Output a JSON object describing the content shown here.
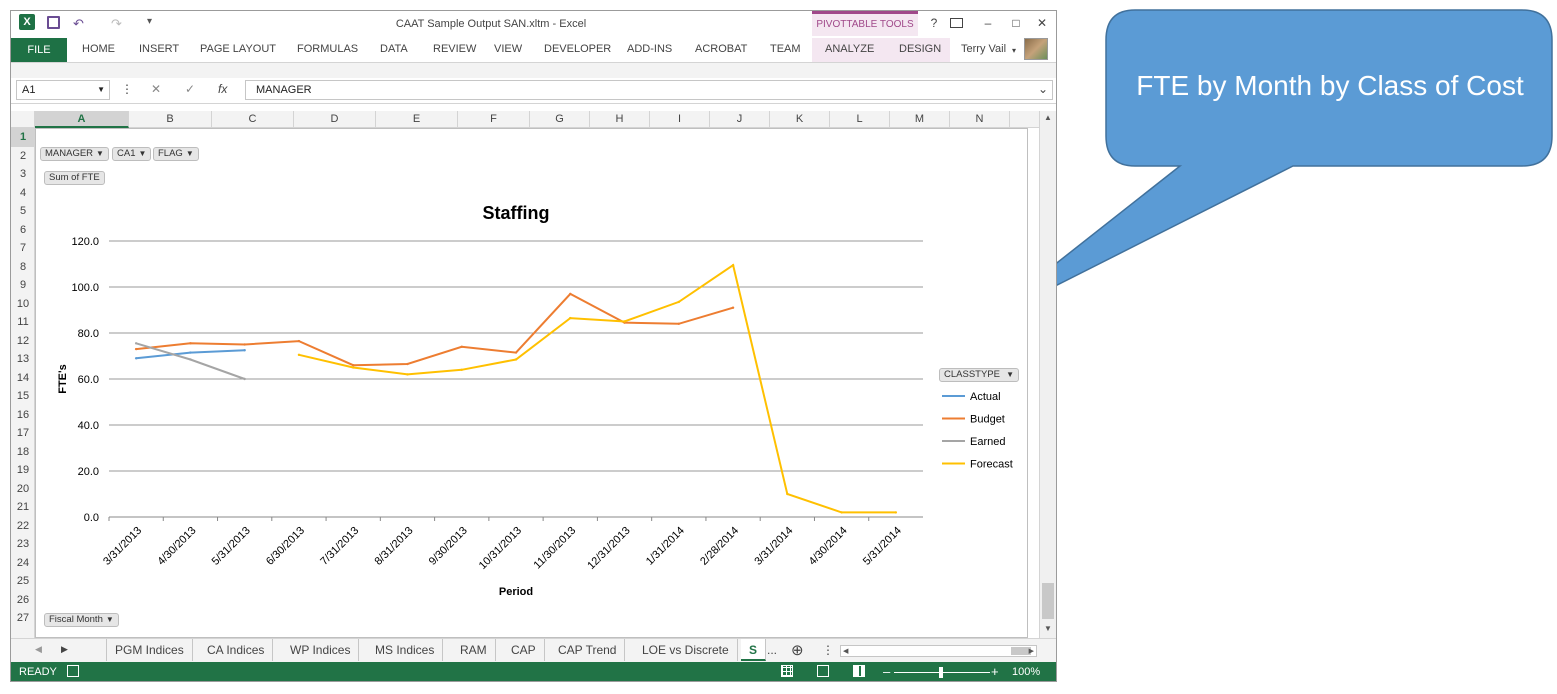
{
  "window": {
    "title": "CAAT Sample Output SAN.xltm - Excel",
    "contextual_tab_group": "PIVOTTABLE TOOLS",
    "help": "?",
    "restore_icon": "ribbon-display-icon",
    "minimize": "–",
    "maximize": "□",
    "close": "✕"
  },
  "quick_access": {
    "excel_icon": "X",
    "save_icon": "save-icon",
    "undo": "↶",
    "redo": "↷",
    "customize": "▾"
  },
  "ribbon": {
    "file": "FILE",
    "tabs": [
      "HOME",
      "INSERT",
      "PAGE LAYOUT",
      "FORMULAS",
      "DATA",
      "REVIEW",
      "VIEW",
      "DEVELOPER",
      "ADD-INS",
      "ACROBAT",
      "TEAM",
      "ANALYZE",
      "DESIGN"
    ],
    "user": "Terry Vail",
    "user_caret": "▾"
  },
  "formula_bar": {
    "name_box": "A1",
    "cancel": "✕",
    "enter": "✓",
    "fx": "fx",
    "value": "MANAGER",
    "expand": "⌄"
  },
  "columns": [
    "A",
    "B",
    "C",
    "D",
    "E",
    "F",
    "G",
    "H",
    "I",
    "J",
    "K",
    "L",
    "M",
    "N"
  ],
  "selected_column": "A",
  "rows": [
    "1",
    "2",
    "3",
    "4",
    "5",
    "6",
    "7",
    "8",
    "9",
    "10",
    "11",
    "12",
    "13",
    "14",
    "15",
    "16",
    "17",
    "18",
    "19",
    "20",
    "21",
    "22",
    "23",
    "24",
    "25",
    "26",
    "27"
  ],
  "pivot_buttons": {
    "manager": "MANAGER",
    "ca1": "CA1",
    "flag": "FLAG",
    "sum": "Sum of FTE",
    "fiscal_month": "Fiscal Month",
    "classtype": "CLASSTYPE",
    "dropdown": "▼"
  },
  "chart_data": {
    "type": "line",
    "title": "Staffing",
    "xlabel": "Period",
    "ylabel": "FTE's",
    "ylim": [
      0,
      120
    ],
    "yticks": [
      "0.0",
      "20.0",
      "40.0",
      "60.0",
      "80.0",
      "100.0",
      "120.0"
    ],
    "categories": [
      "3/31/2013",
      "4/30/2013",
      "5/31/2013",
      "6/30/2013",
      "7/31/2013",
      "8/31/2013",
      "9/30/2013",
      "10/31/2013",
      "11/30/2013",
      "12/31/2013",
      "1/31/2014",
      "2/28/2014",
      "3/31/2014",
      "4/30/2014",
      "5/31/2014"
    ],
    "grid": true,
    "legend_position": "right",
    "series": [
      {
        "name": "Actual",
        "color": "#5b9bd5",
        "values": [
          69,
          71.5,
          72.5,
          null,
          null,
          null,
          null,
          null,
          null,
          null,
          null,
          null,
          null,
          null,
          null
        ]
      },
      {
        "name": "Budget",
        "color": "#ed7d31",
        "values": [
          73,
          75.5,
          75,
          76.5,
          66,
          66.5,
          74,
          71.5,
          97,
          84.5,
          84,
          91,
          null,
          null,
          null
        ]
      },
      {
        "name": "Earned",
        "color": "#a5a5a5",
        "values": [
          75.5,
          68.5,
          60,
          null,
          null,
          null,
          null,
          null,
          null,
          null,
          null,
          null,
          null,
          null,
          null
        ]
      },
      {
        "name": "Forecast",
        "color": "#ffc000",
        "values": [
          null,
          null,
          null,
          70.5,
          65,
          62,
          64,
          68.5,
          86.5,
          85,
          93.5,
          109.5,
          10,
          2,
          2
        ]
      }
    ]
  },
  "sheet_tabs": [
    "PGM Indices",
    "CA Indices",
    "WP Indices",
    "MS Indices",
    "RAM",
    "CAP",
    "CAP Trend",
    "LOE vs Discrete",
    "S"
  ],
  "active_sheet": "S",
  "tab_nav": {
    "prev": "◀",
    "next": "▶",
    "more": "...",
    "add": "⊕",
    "options": "⋮",
    "scroll_left": "◀",
    "scroll_right": "▶"
  },
  "status": {
    "ready": "READY",
    "zoom_minus": "–",
    "zoom_plus": "+",
    "zoom": "100%",
    "zoom_level": 1.0
  },
  "callout": {
    "text": "FTE by Month by Class of Cost",
    "fill": "#5b9bd5",
    "stroke": "#41719c"
  }
}
